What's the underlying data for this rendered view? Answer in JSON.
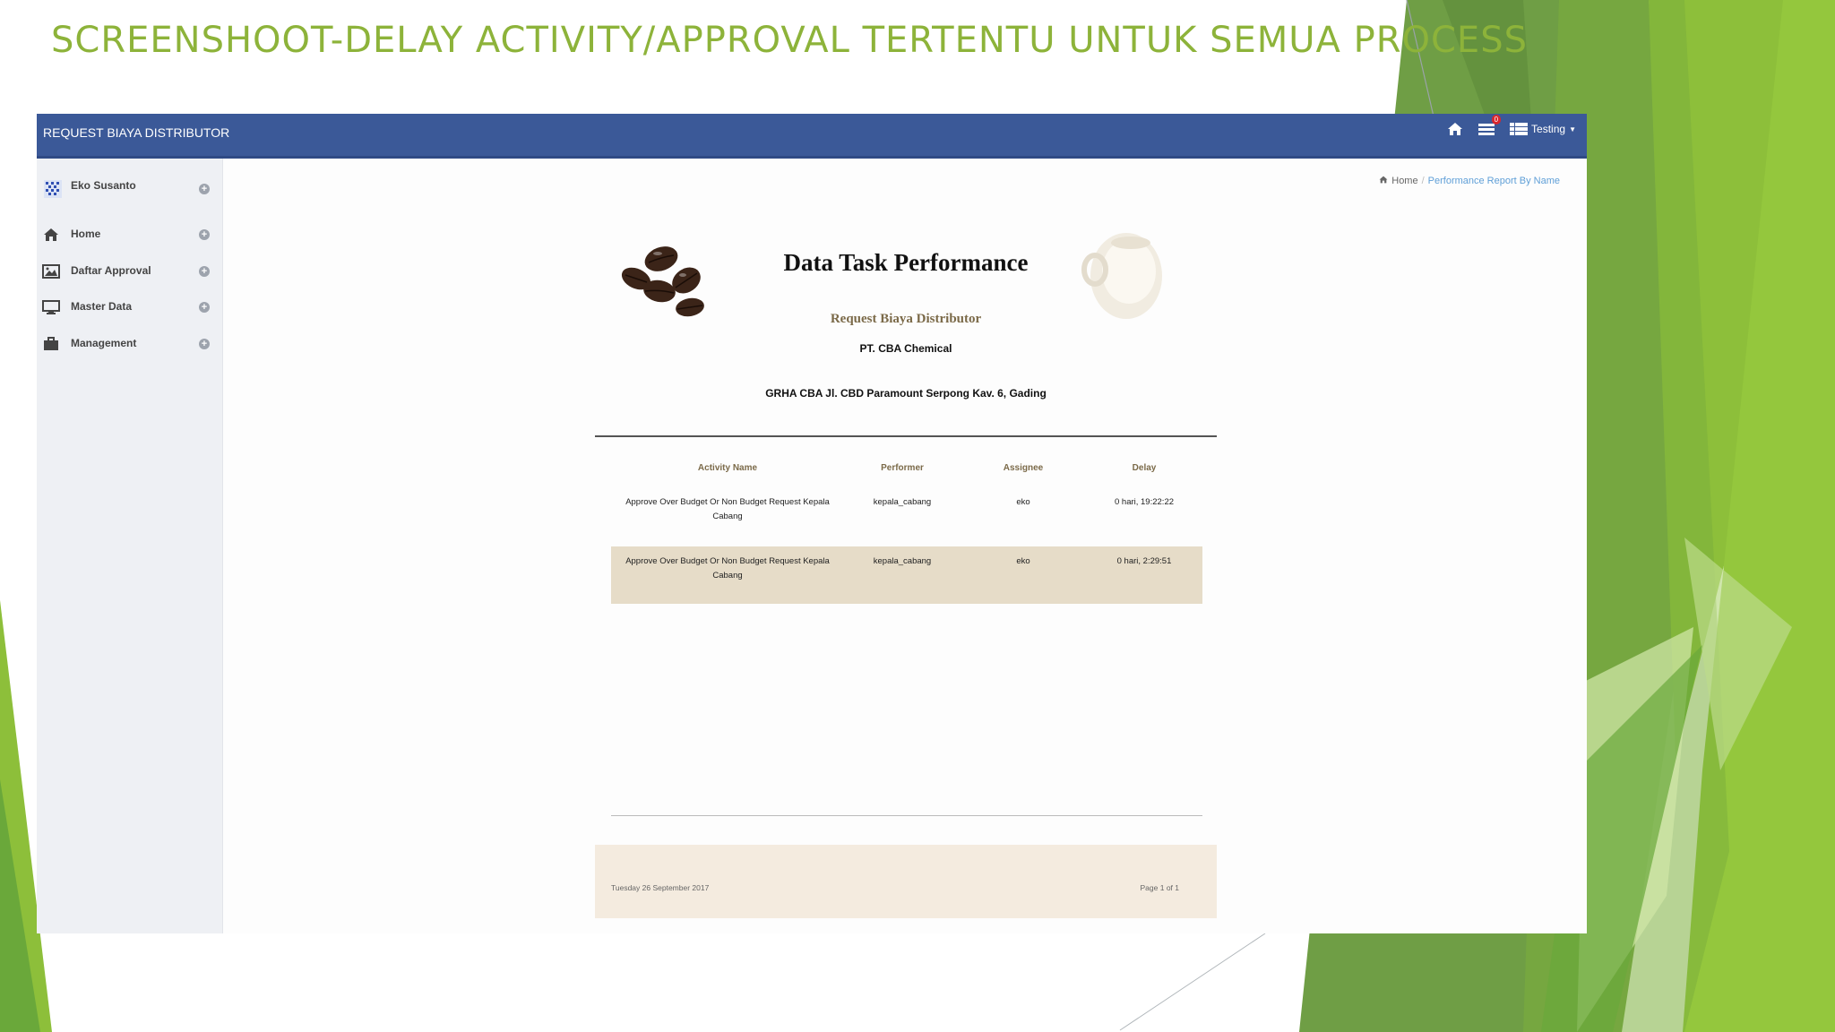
{
  "slide": {
    "title": "SCREENSHOOT-DELAY ACTIVITY/APPROVAL TERTENTU UNTUK SEMUA PROCESS"
  },
  "app": {
    "title": "REQUEST BIAYA DISTRIBUTOR",
    "header": {
      "notification_count": "0",
      "user_menu": "Testing"
    },
    "sidebar": {
      "user": "Eko Susanto",
      "items": [
        {
          "label": "Home",
          "icon": "home-icon"
        },
        {
          "label": "Daftar Approval",
          "icon": "image-icon"
        },
        {
          "label": "Master Data",
          "icon": "monitor-icon"
        },
        {
          "label": "Management",
          "icon": "briefcase-icon"
        }
      ]
    },
    "breadcrumb": {
      "home": "Home",
      "current": "Performance Report By Name"
    }
  },
  "report": {
    "title": "Data Task Performance",
    "subtitle": "Request Biaya Distributor",
    "company": "PT. CBA Chemical",
    "address": "GRHA CBA Jl. CBD Paramount Serpong Kav. 6, Gading",
    "columns": [
      "Activity Name",
      "Performer",
      "Assignee",
      "Delay"
    ],
    "rows": [
      {
        "activity": "Approve Over Budget Or Non Budget Request Kepala Cabang",
        "performer": "kepala_cabang",
        "assignee": "eko",
        "delay": "0 hari, 19:22:22"
      },
      {
        "activity": "Approve Over Budget Or Non Budget Request Kepala Cabang",
        "performer": "kepala_cabang",
        "assignee": "eko",
        "delay": "0 hari, 2:29:51"
      }
    ],
    "footer": {
      "date": "Tuesday 26 September 2017",
      "page": "Page 1 of 1"
    }
  },
  "colors": {
    "header_bg": "#3b5998",
    "slide_title": "#8db33a",
    "highlight_row": "#e6dcc8",
    "footer_bg": "#f4ebdf"
  }
}
